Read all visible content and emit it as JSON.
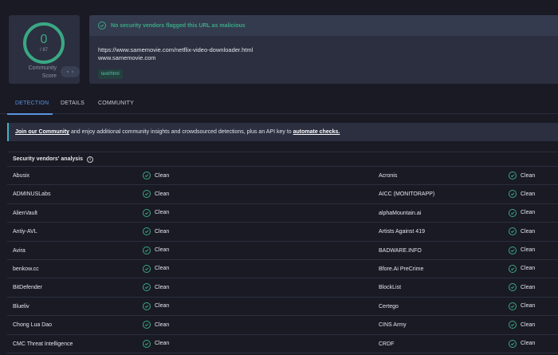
{
  "score": {
    "value": "0",
    "total": "/ 87",
    "label_line1": "Community",
    "label_line2": "Score"
  },
  "summary": {
    "banner": "No security vendors flagged this URL as malicious",
    "url": "https://www.samemovie.com/netflix-video-downloader.html",
    "domain": "www.samemovie.com",
    "tag": "text/html"
  },
  "tabs": [
    {
      "label": "DETECTION",
      "active": true
    },
    {
      "label": "DETAILS",
      "active": false
    },
    {
      "label": "COMMUNITY",
      "active": false
    }
  ],
  "join_banner": {
    "link1": "Join our Community",
    "text": " and enjoy additional community insights and crowdsourced detections, plus an API key to ",
    "link2": "automate checks."
  },
  "analysis": {
    "title": "Security vendors' analysis",
    "rows": [
      {
        "left": "Abusix",
        "left_result": "Clean",
        "right": "Acronis",
        "right_result": "Clean"
      },
      {
        "left": "ADMINUSLabs",
        "left_result": "Clean",
        "right": "AICC (MONITORAPP)",
        "right_result": "Clean"
      },
      {
        "left": "AlienVault",
        "left_result": "Clean",
        "right": "alphaMountain.ai",
        "right_result": "Clean"
      },
      {
        "left": "Antiy-AVL",
        "left_result": "Clean",
        "right": "Artists Against 419",
        "right_result": "Clean"
      },
      {
        "left": "Avira",
        "left_result": "Clean",
        "right": "BADWARE.INFO",
        "right_result": "Clean"
      },
      {
        "left": "benkow.cc",
        "left_result": "Clean",
        "right": "Bfore.Ai PreCrime",
        "right_result": "Clean"
      },
      {
        "left": "BitDefender",
        "left_result": "Clean",
        "right": "BlockList",
        "right_result": "Clean"
      },
      {
        "left": "Blueliv",
        "left_result": "Clean",
        "right": "Certego",
        "right_result": "Clean"
      },
      {
        "left": "Chong Lua Dao",
        "left_result": "Clean",
        "right": "CINS Army",
        "right_result": "Clean"
      },
      {
        "left": "CMC Threat Intelligence",
        "left_result": "Clean",
        "right": "CRDF",
        "right_result": "Clean"
      }
    ]
  },
  "colors": {
    "background": "#191a23",
    "card": "#2b2f3f",
    "clean_green": "#3aa884",
    "accent_blue": "#5a91e2",
    "banner_accent": "#40b3c7"
  },
  "icons": {
    "banner": "check-circle-icon",
    "result": "check-circle-icon",
    "info": "info-icon"
  }
}
